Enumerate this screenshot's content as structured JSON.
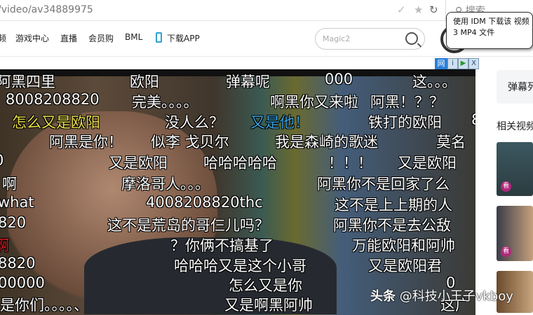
{
  "address": {
    "url": "/video/av34889975",
    "search_placeholder": "搜索"
  },
  "nav": {
    "items": [
      "频",
      "游戏中心",
      "直播",
      "会员购",
      "BML",
      "下载APP"
    ],
    "search_placeholder": "Magic2"
  },
  "idm": {
    "tooltip_line1": "使用 IDM 下载该 视频",
    "tooltip_line2": "3 MP4 文件",
    "bar_label": "网",
    "close": "X"
  },
  "danmaku": [
    {
      "t": "阿黑四里",
      "c": "#ffffff"
    },
    {
      "t": "欧阳",
      "c": "#ffffff"
    },
    {
      "t": "弹幕呢",
      "c": "#ffffff"
    },
    {
      "t": "000",
      "c": "#ffffff"
    },
    {
      "t": "这。。。",
      "c": "#ffffff"
    },
    {
      "t": "8008208820",
      "c": "#ffffff"
    },
    {
      "t": "完美。。。。",
      "c": "#ffffff"
    },
    {
      "t": "啊黑你又来啦",
      "c": "#ffffff"
    },
    {
      "t": "阿黑！？？",
      "c": "#ffffff"
    },
    {
      "t": "怎么又是欧阳",
      "c": "#e8e04a"
    },
    {
      "t": "没人么？",
      "c": "#ffffff"
    },
    {
      "t": "又是他！",
      "c": "#3aa0dc"
    },
    {
      "t": "铁打的欧阳",
      "c": "#ffffff"
    },
    {
      "t": "8",
      "c": "#ffffff"
    },
    {
      "t": "阿黑是你！",
      "c": "#ffffff"
    },
    {
      "t": "似李 戈贝尔",
      "c": "#ffffff"
    },
    {
      "t": "我是森崎的歌迷",
      "c": "#ffffff"
    },
    {
      "t": "莫名",
      "c": "#ffffff"
    },
    {
      "t": "0",
      "c": "#ffffff"
    },
    {
      "t": "又是欧阳",
      "c": "#ffffff"
    },
    {
      "t": "哈哈哈哈哈",
      "c": "#ffffff"
    },
    {
      "t": "！！！",
      "c": "#ffffff"
    },
    {
      "t": "又是欧阳",
      "c": "#ffffff"
    },
    {
      "t": "啊",
      "c": "#ffffff"
    },
    {
      "t": "摩洛哥人。。。",
      "c": "#ffffff"
    },
    {
      "t": "阿黑你不是回家了么",
      "c": "#ffffff"
    },
    {
      "t": "what",
      "c": "#ffffff"
    },
    {
      "t": "4008208820thc",
      "c": "#ffffff"
    },
    {
      "t": "这不是上上期的人",
      "c": "#ffffff"
    },
    {
      "t": "820",
      "c": "#ffffff"
    },
    {
      "t": "这不是荒岛的哥仨儿吗？",
      "c": "#ffffff"
    },
    {
      "t": "阿黑你不是去公敌",
      "c": "#ffffff"
    },
    {
      "t": "啊",
      "c": "#e02020"
    },
    {
      "t": "？你俩不搞基了",
      "c": "#ffffff"
    },
    {
      "t": "万能欧阳和阿帅",
      "c": "#ffffff"
    },
    {
      "t": "8820",
      "c": "#ffffff"
    },
    {
      "t": "哈哈哈又是这个小哥",
      "c": "#ffffff"
    },
    {
      "t": "又是欧阳君",
      "c": "#ffffff"
    },
    {
      "t": "00000",
      "c": "#ffffff"
    },
    {
      "t": "怎么又是你",
      "c": "#ffffff"
    },
    {
      "t": "0",
      "c": "#ffffff"
    },
    {
      "t": "是你们。。。。、",
      "c": "#ffffff"
    },
    {
      "t": "又是啊黑阿帅",
      "c": "#ffffff"
    },
    {
      "t": "这广",
      "c": "#ffffff"
    }
  ],
  "watermark": {
    "brand": "头条",
    "handle": "@科技小王子vkboy"
  },
  "sidebar": {
    "danmaku_list": "弹幕列表",
    "related": "相关视频",
    "badge": "看"
  }
}
